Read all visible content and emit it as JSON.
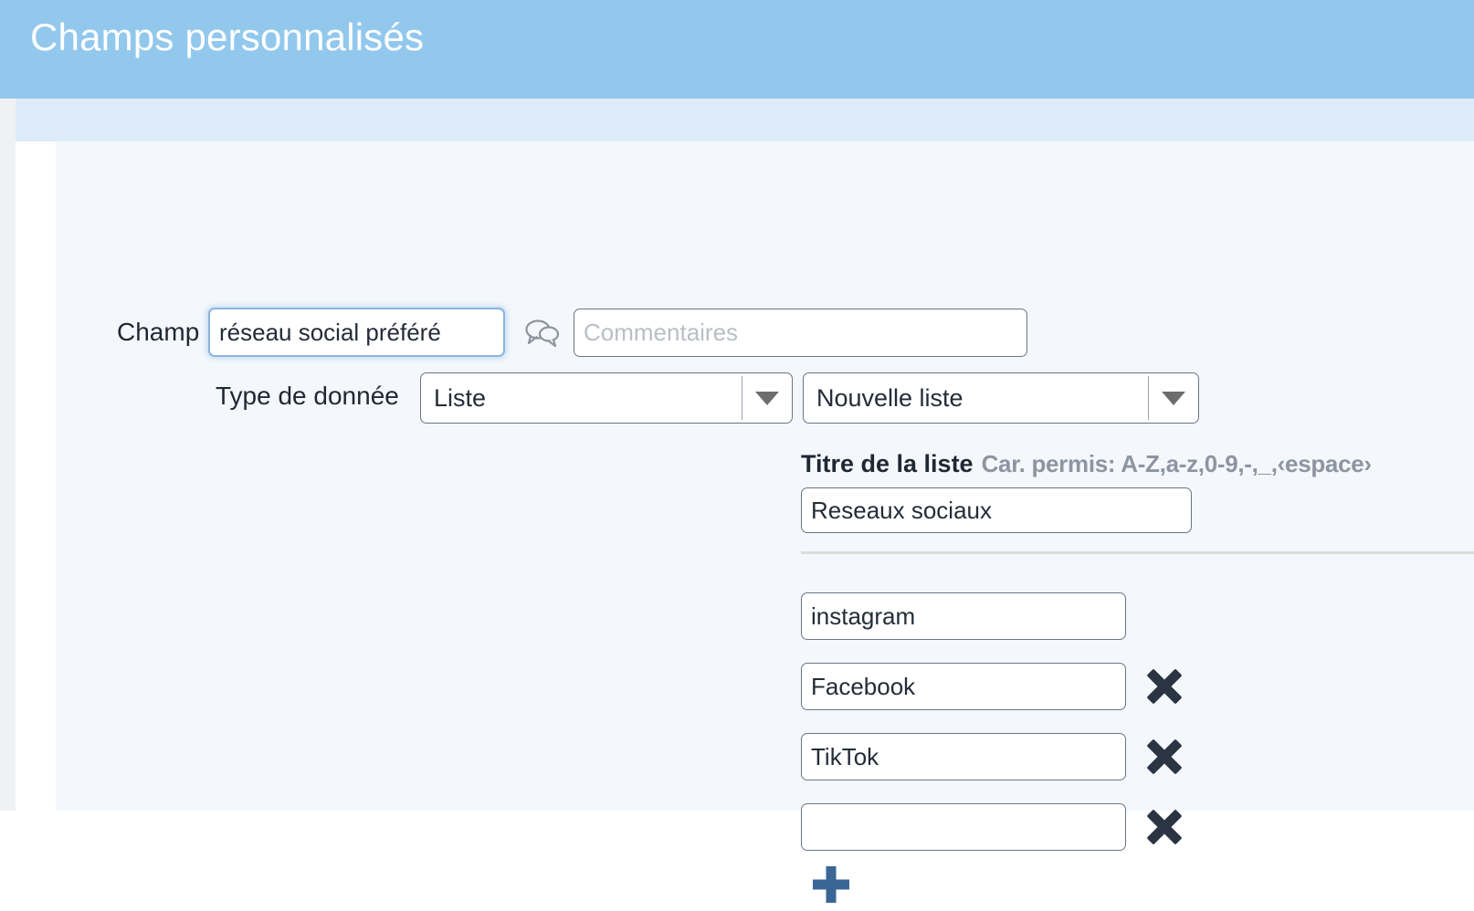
{
  "header": {
    "title": "Champs personnalisés",
    "background_color": "#93c8ed",
    "text_color": "#ffffff"
  },
  "form": {
    "champ": {
      "label": "Champ",
      "value": "réseau social préféré",
      "placeholder": "",
      "focused": true
    },
    "comment_icon": "comment-bubbles-icon",
    "commentaires": {
      "value": "",
      "placeholder": "Commentaires"
    },
    "type_de_donnee": {
      "label": "Type de donnée",
      "selected": "Liste"
    },
    "liste_source": {
      "selected": "Nouvelle liste"
    }
  },
  "list_editor": {
    "titre_label": "Titre de la liste",
    "titre_hint": "Car. permis: A-Z,a-z,0-9,-,_,‹espace›",
    "titre_value": "Reseaux sociaux",
    "titre_placeholder": "",
    "options": [
      {
        "value": "instagram",
        "removable": false
      },
      {
        "value": "Facebook",
        "removable": true
      },
      {
        "value": "TikTok",
        "removable": true
      },
      {
        "value": "",
        "removable": true
      }
    ],
    "add_button": "add-option-icon",
    "remove_button": "remove-option-icon",
    "accent_color": "#3a6695",
    "remove_color": "#2b3442"
  }
}
